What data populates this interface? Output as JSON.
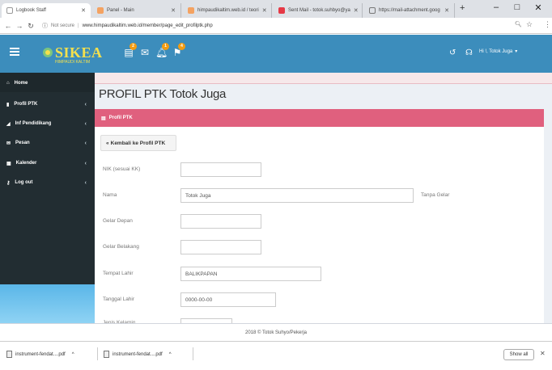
{
  "browser": {
    "tabs": [
      {
        "title": "Logbook Staff",
        "favicon_color": "#4a89dc",
        "active": true
      },
      {
        "title": "Panel - Main",
        "favicon_color": "#f4a261",
        "active": false
      },
      {
        "title": "himpaudikaltim.web.id / teori",
        "favicon_color": "#f4a261",
        "active": false
      },
      {
        "title": "Sent Mail - totok.suhbyo@ya",
        "favicon_color": "#e63946",
        "active": false
      },
      {
        "title": "https://mail-attachment.goog",
        "favicon_color": "#777777",
        "active": false
      }
    ],
    "new_tab": "+",
    "window_controls": {
      "minimize": "–",
      "maximize": "□",
      "close": "✕"
    },
    "address": {
      "security": "Not secure",
      "url": "www.himpaudikaltim.web.id/member/page_edit_profilptk.php"
    }
  },
  "header": {
    "menu_icon": "hamburger-icon",
    "logo_text": "SIKEA",
    "logo_sub": "HIMPAUDI KALTIM",
    "notifications": [
      {
        "icon": "document-icon",
        "badge": "2"
      },
      {
        "icon": "envelope-icon",
        "badge": ""
      },
      {
        "icon": "bell-icon",
        "badge": "1"
      },
      {
        "icon": "flag-icon",
        "badge": "4"
      }
    ],
    "user_label": "Hi !, Totok Juga"
  },
  "sidebar": {
    "items": [
      {
        "label": "Home",
        "icon": "home-icon"
      },
      {
        "label": "Profil PTK",
        "icon": "book-icon"
      },
      {
        "label": "Inf Pendidikang",
        "icon": "chart-icon"
      },
      {
        "label": "Pesan",
        "icon": "envelope-icon"
      },
      {
        "label": "Kalender",
        "icon": "calendar-icon"
      },
      {
        "label": "Log out",
        "icon": "key-icon"
      }
    ]
  },
  "main": {
    "page_title": "PROFIL PTK Totok Juga",
    "box_title": "Profil PTK",
    "back_button": "Kembali ke Profil PTK",
    "fields": [
      {
        "label": "NIK (sesuai KK)",
        "value": "",
        "width": "short"
      },
      {
        "label": "Nama",
        "value": "Totok Juga",
        "width": "long",
        "hint": "Tanpa Gelar"
      },
      {
        "label": "Gelar Depan",
        "value": "",
        "width": "short"
      },
      {
        "label": "Gelar Belakang",
        "value": "",
        "width": "short"
      },
      {
        "label": "Tempat Lahir",
        "value": "BALIKPAPAN",
        "width": "medium"
      },
      {
        "label": "Tanggal Lahir",
        "value": "0000-00-00",
        "width": "medium"
      },
      {
        "label": "Jenis Kelamin",
        "value": "",
        "width": "select"
      }
    ]
  },
  "footer": {
    "text": "2018 © Totok Suhyo/Pekerja"
  },
  "downloads": {
    "items": [
      {
        "name": "instrument-fendat....pdf"
      },
      {
        "name": "instrument-fendat....pdf"
      }
    ],
    "show_all": "Show all",
    "close": "✕"
  },
  "colors": {
    "header_blue": "#3c8dbc",
    "sidebar_dark": "#222d32",
    "box_pink": "#e0607e",
    "logo_yellow": "#f4e04d",
    "badge_orange": "#f39c12"
  }
}
